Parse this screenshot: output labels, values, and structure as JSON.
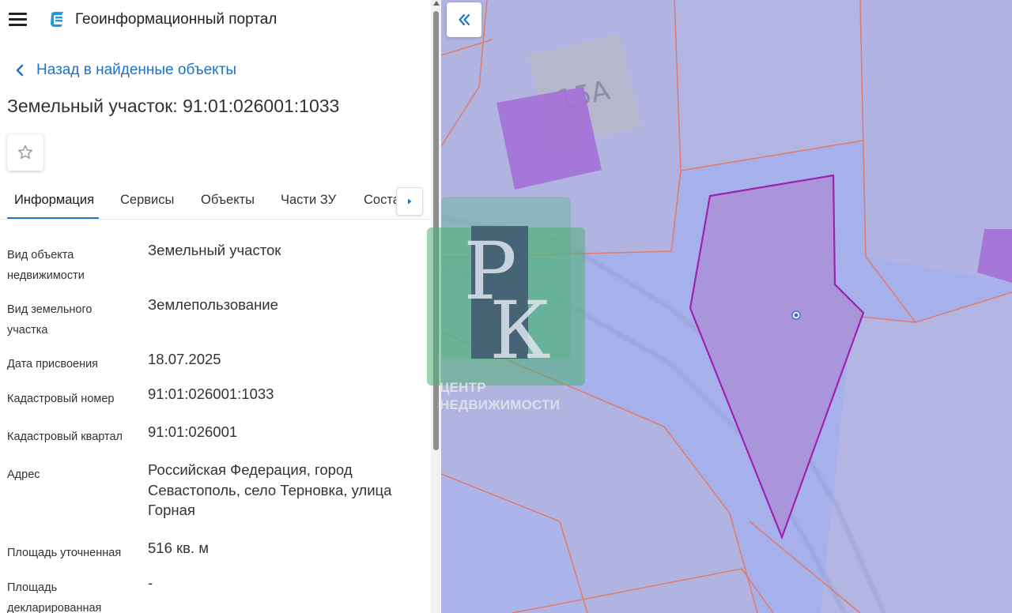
{
  "header": {
    "menu_icon": "hamburger-menu-icon",
    "logo_icon": "geoportal-logo-icon",
    "title": "Геоинформационный портал"
  },
  "back_link": {
    "icon": "chevron-left-icon",
    "label": "Назад в найденные объекты"
  },
  "object": {
    "title": "Земельный участок: 91:01:026001:1033"
  },
  "favorite": {
    "icon": "star-outline-icon"
  },
  "tabs": [
    {
      "label": "Информация",
      "active": true
    },
    {
      "label": "Сервисы"
    },
    {
      "label": "Объекты"
    },
    {
      "label": "Части ЗУ"
    },
    {
      "label": "Соста"
    }
  ],
  "tabs_scroll_icon": "caret-right-icon",
  "properties": [
    {
      "label": "Вид объекта недвижимости",
      "value": "Земельный участок"
    },
    {
      "label": "Вид земельного участка",
      "value": "Землепользование"
    },
    {
      "label": "Дата присвоения",
      "value": "18.07.2025"
    },
    {
      "label": "Кадастровый номер",
      "value": "91:01:026001:1033"
    },
    {
      "label": "Кадастровый квартал",
      "value": "91:01:026001"
    },
    {
      "label": "Адрес",
      "value": "Российская Федерация, город Севастополь, село Терновка, улица Горная"
    },
    {
      "label": "Площадь уточненная",
      "value": "516 кв. м"
    },
    {
      "label": "Площадь декларированная",
      "value": "-"
    }
  ],
  "map": {
    "collapse_icon": "double-chevron-left-icon",
    "building_label": "15А",
    "colors": {
      "parcel_fill": "#b1b3e1",
      "road_fill": "#a6b8f2",
      "boundary": "#e07a6a",
      "selected_fill": "#aa92d9",
      "selected_stroke": "#a020b0",
      "building": "#a470d8",
      "gray_building": "#b7b6c9"
    }
  },
  "watermark": {
    "letters": "РК",
    "caption_line1": "ЦЕНТР",
    "caption_line2": "НЕДВИЖИМОСТИ"
  }
}
